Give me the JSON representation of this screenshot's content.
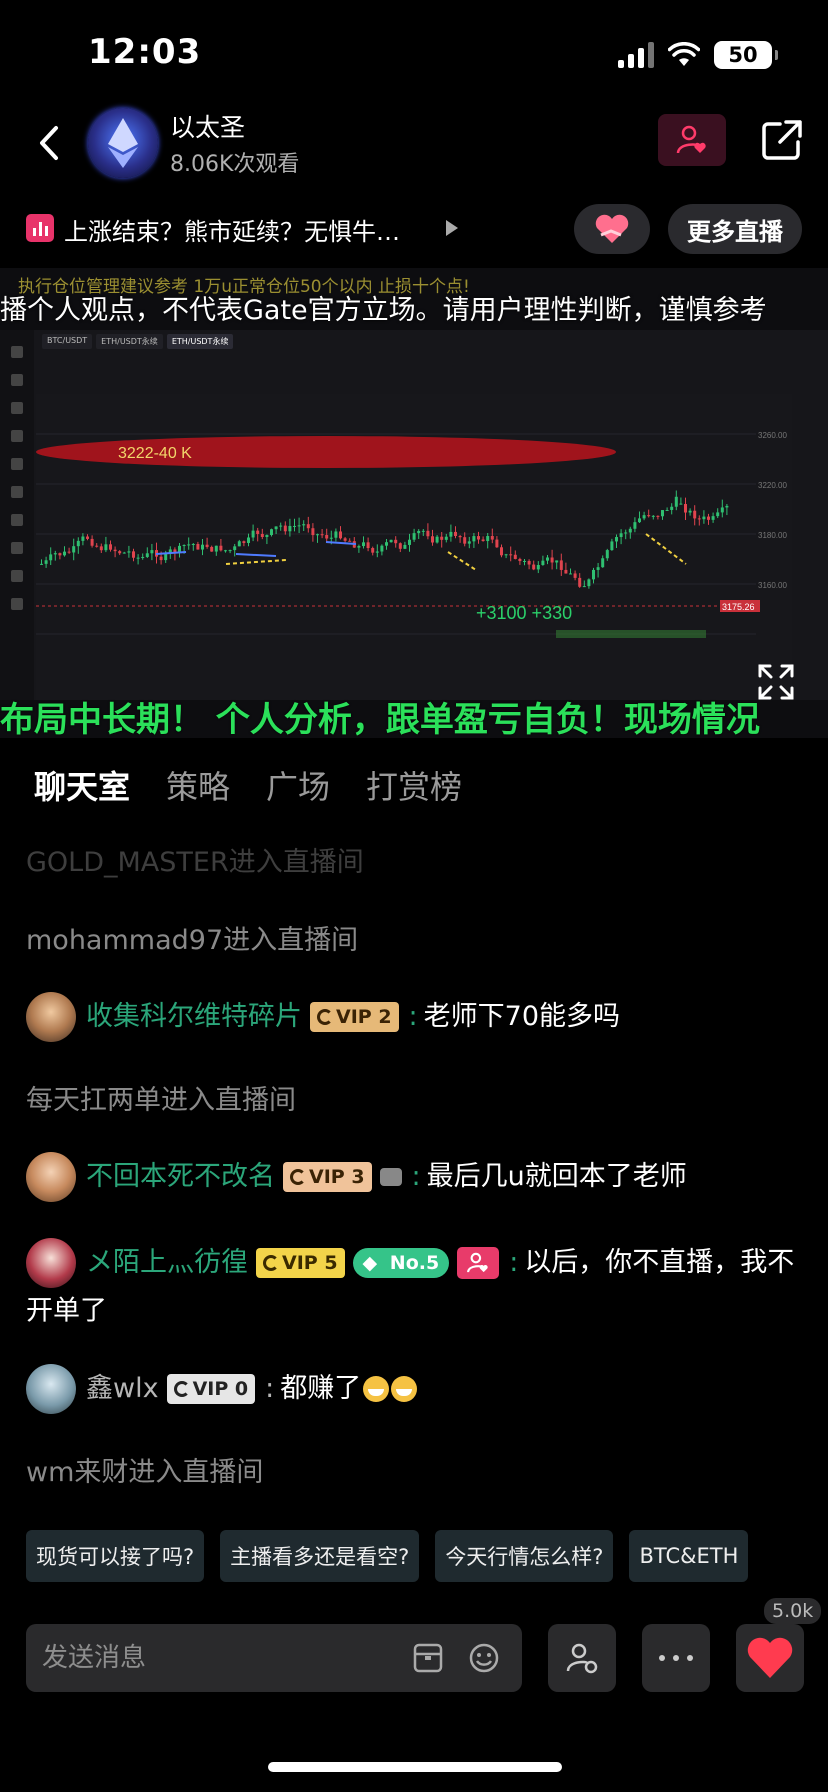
{
  "status": {
    "time": "12:03",
    "battery": "50"
  },
  "header": {
    "title": "以太圣",
    "views": "8.06K次观看"
  },
  "topic": {
    "text": "上涨结束？熊市延续？无惧牛…",
    "more_live": "更多直播"
  },
  "video": {
    "ticker_top": "执行仓位管理建议参考   1万u正常仓位50个以内   止损十个点!",
    "caption_top": "播个人观点，不代表Gate官方立场。请用户理性判断，谨慎参考",
    "caption_bottom": "布局中长期！ 个人分析，跟单盈亏自负！现场情况",
    "chart_tabs": [
      "BTC/USDT",
      "ETH/USDT永续",
      "ETH/USDT永续"
    ],
    "zone_label": "3222-40 K",
    "price_label": "3175.26",
    "annotation": "+3100 +330"
  },
  "tabs": [
    "聊天室",
    "策略",
    "广场",
    "打赏榜"
  ],
  "chat": {
    "sys1": "GOLD_MASTER进入直播间",
    "sys2": "mohammad97进入直播间",
    "msg1": {
      "user": "收集科尔维特碎片",
      "vip": "VIP 2",
      "text": "老师下70能多吗"
    },
    "sys3": "每天扛两单进入直播间",
    "msg2": {
      "user": "不回本死不改名",
      "vip": "VIP 3",
      "text": "最后几u就回本了老师"
    },
    "msg3": {
      "user": "メ陌上灬彷徨",
      "vip": "VIP 5",
      "rank": "No.5",
      "text": "以后，你不直播，我不开单了"
    },
    "msg4": {
      "user": "鑫wlx",
      "vip": "VIP 0",
      "text": "都赚了"
    },
    "sys4": "wm来财进入直播间"
  },
  "chips": [
    "现货可以接了吗?",
    "主播看多还是看空?",
    "今天行情怎么样?",
    "BTC&ETH"
  ],
  "input": {
    "placeholder": "发送消息"
  },
  "likes": "5.0k",
  "colors": {
    "accent_green": "#2ba67a",
    "heart_red": "#ff3b4f",
    "caption_green": "#2be05a"
  }
}
